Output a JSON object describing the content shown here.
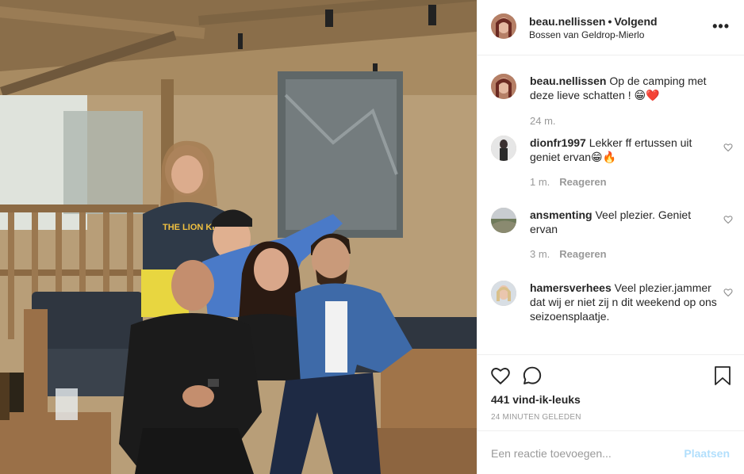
{
  "post": {
    "username": "beau.nellissen",
    "separator": "•",
    "follow_status": "Volgend",
    "location": "Bossen van Geldrop-Mierlo",
    "more_label": "•••"
  },
  "photo": {
    "shirt_text": "THE LION KING"
  },
  "comments": [
    {
      "username": "beau.nellissen",
      "text": "Op de camping met deze lieve schatten ! 😁❤️",
      "time": "24 m.",
      "reply_label": ""
    },
    {
      "username": "dionfr1997",
      "text": "Lekker ff ertussen uit geniet ervan😁🔥",
      "time": "1 m.",
      "reply_label": "Reageren"
    },
    {
      "username": "ansmenting",
      "text": "Veel plezier. Geniet ervan",
      "time": "3 m.",
      "reply_label": "Reageren"
    },
    {
      "username": "hamersverhees",
      "text": "Veel plezier.jammer dat wij er niet zij n dit weekend op ons seizoensplaatje.",
      "time": "",
      "reply_label": ""
    }
  ],
  "actions": {
    "like_icon": "heart-icon",
    "comment_icon": "speech-bubble-icon",
    "save_icon": "bookmark-icon"
  },
  "likes_text": "441 vind-ik-leuks",
  "timestamp": "24 MINUTEN GELEDEN",
  "add_comment": {
    "placeholder": "Een reactie toevoegen...",
    "post_label": "Plaatsen"
  },
  "colors": {
    "text": "#262626",
    "muted": "#999999",
    "divider": "#efefef",
    "post_button_disabled": "#b2dffc",
    "heart_red": "#ed4956"
  }
}
